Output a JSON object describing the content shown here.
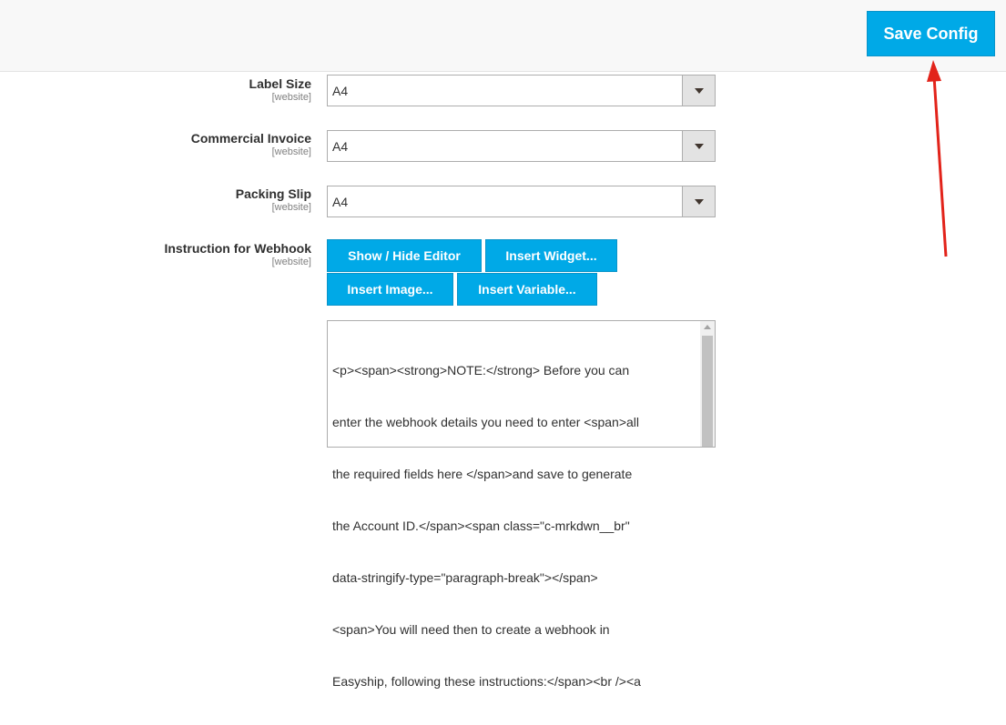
{
  "header": {
    "save_label": "Save Config"
  },
  "fields": [
    {
      "label": "Label Size",
      "scope": "[website]",
      "value": "A4"
    },
    {
      "label": "Commercial Invoice",
      "scope": "[website]",
      "value": "A4"
    },
    {
      "label": "Packing Slip",
      "scope": "[website]",
      "value": "A4"
    }
  ],
  "webhook": {
    "label": "Instruction for Webhook",
    "scope": "[website]",
    "buttons": [
      "Show / Hide Editor",
      "Insert Widget...",
      "Insert Image...",
      "Insert Variable..."
    ],
    "editor_lines": [
      "<p><span><strong>NOTE:</strong> Before you can",
      "enter the webhook details you need to enter <span>all",
      "the required fields here </span>and save to generate",
      "the Account ID.</span><span class=\"c-mrkdwn__br\"",
      "data-stringify-type=\"paragraph-break\"></span>",
      "<span>You will need then to create a webhook in",
      "Easyship, following these instructions:</span><br /><a"
    ]
  },
  "colors": {
    "accent": "#00a9e7",
    "arrow": "#e2231a"
  },
  "icons": [
    "chevron-down-icon",
    "annotation-arrow-icon",
    "scroll-up-icon"
  ]
}
